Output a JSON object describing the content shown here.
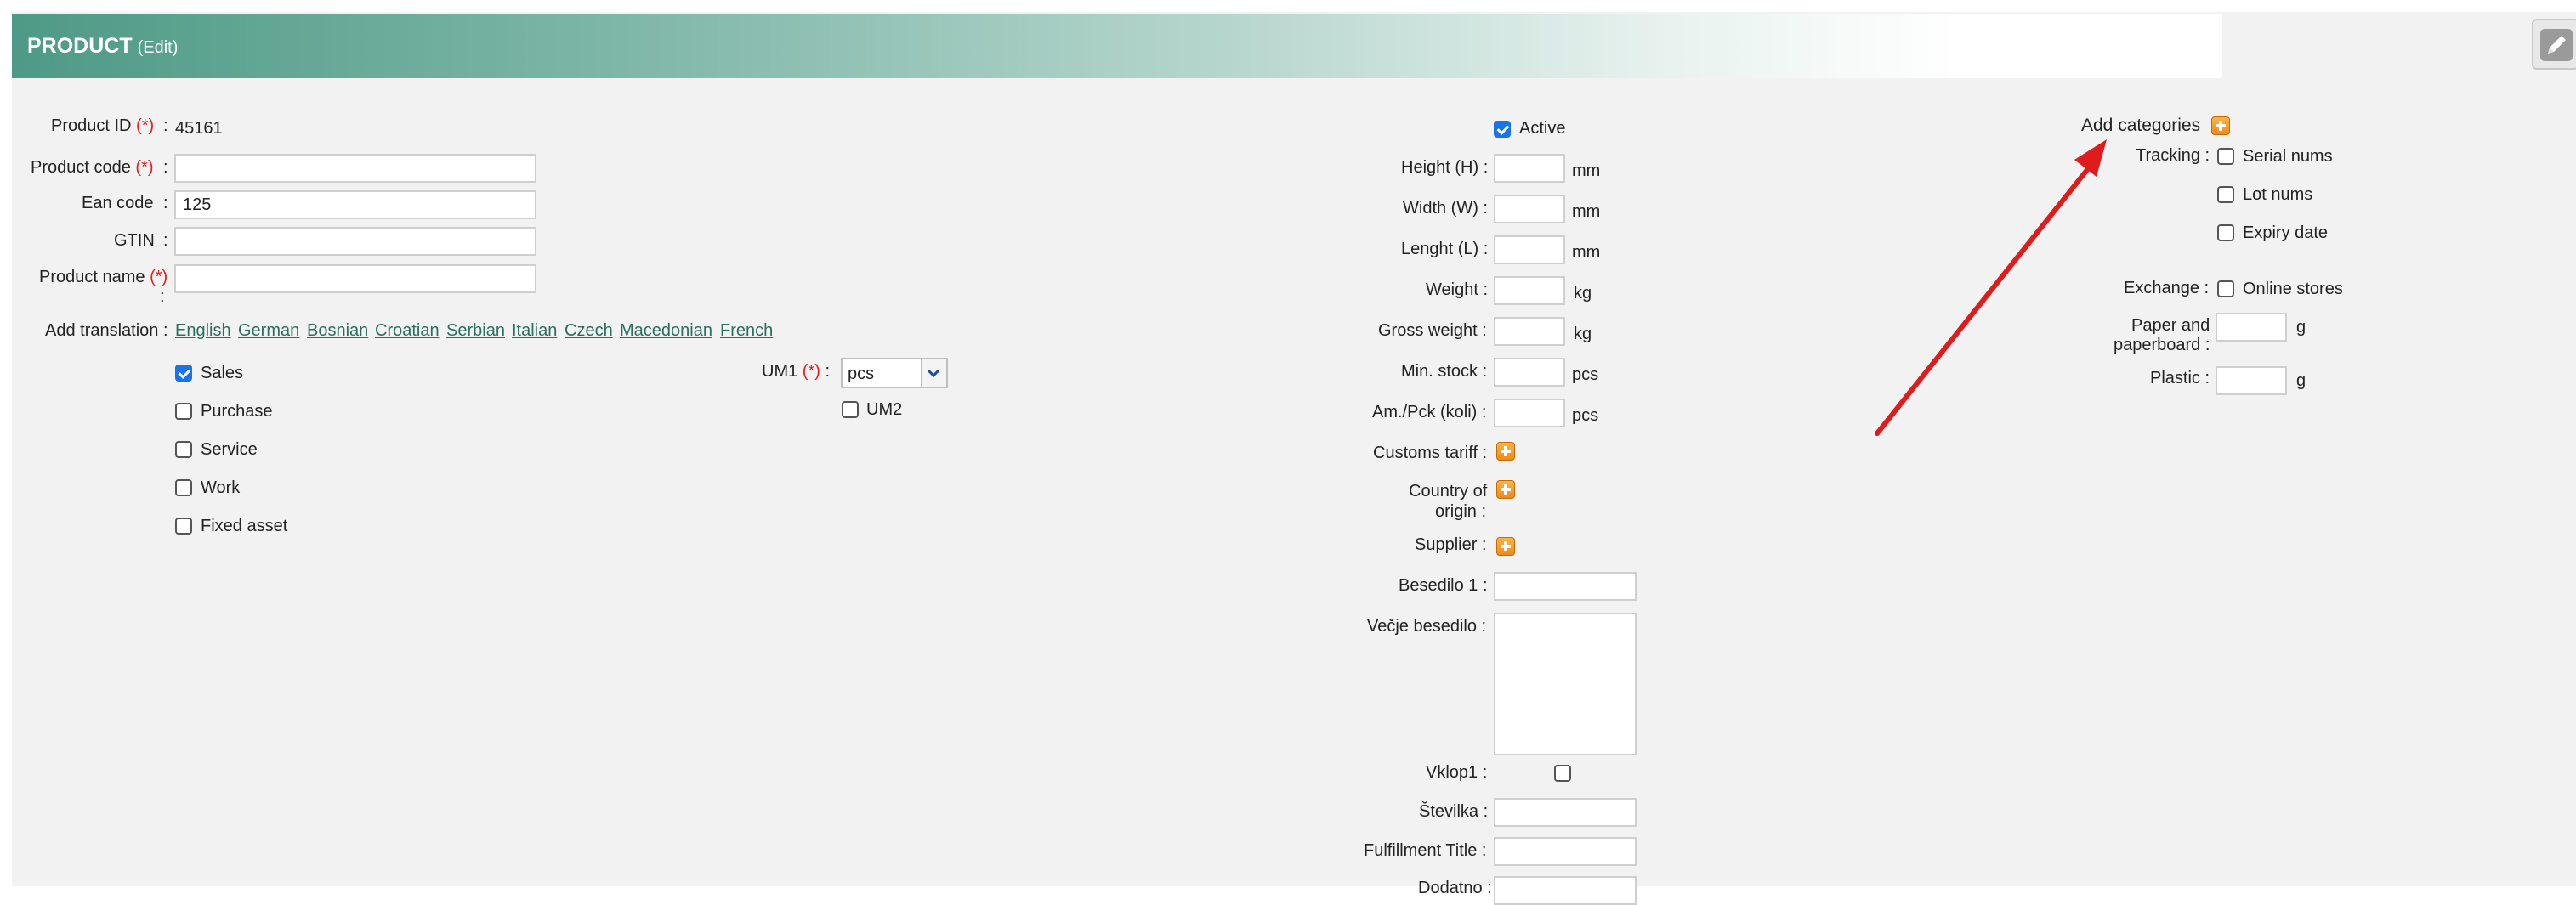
{
  "header": {
    "title": "PRODUCT",
    "subtitle": "(Edit)"
  },
  "req_mark": "(*)",
  "colon": ":",
  "left": {
    "product_id_label": "Product ID",
    "product_id_value": "45161",
    "product_code_label": "Product code",
    "product_code_value": "",
    "ean_label": "Ean code",
    "ean_value": "125",
    "gtin_label": "GTIN",
    "gtin_value": "",
    "product_name_label": "Product name",
    "product_name_value": "",
    "add_translation_label": "Add translation :",
    "languages": [
      "English",
      "German",
      "Bosnian",
      "Croatian",
      "Serbian",
      "Italian",
      "Czech",
      "Macedonian",
      "French"
    ],
    "types": [
      {
        "label": "Sales",
        "checked": true
      },
      {
        "label": "Purchase",
        "checked": false
      },
      {
        "label": "Service",
        "checked": false
      },
      {
        "label": "Work",
        "checked": false
      },
      {
        "label": "Fixed asset",
        "checked": false
      }
    ],
    "um1_label": "UM1",
    "um1_value": "pcs",
    "um2_label": "UM2"
  },
  "middle": {
    "active_label": "Active",
    "height_label": "Height (H) :",
    "width_label": "Width (W) :",
    "length_label": "Lenght (L) :",
    "weight_label": "Weight :",
    "gross_weight_label": "Gross weight :",
    "min_stock_label": "Min. stock :",
    "am_pck_label": "Am./Pck (koli) :",
    "unit_mm": "mm",
    "unit_kg": "kg",
    "unit_pcs": "pcs",
    "customs_label": "Customs tariff :",
    "country_label_1": "Country of",
    "country_label_2": "origin :",
    "supplier_label": "Supplier :",
    "besedilo_label": "Besedilo 1 :",
    "vecje_label": "Večje besedilo :",
    "vklop_label": "Vklop1 :",
    "stevilka_label": "Številka :",
    "fulfillment_label": "Fulfillment Title :",
    "cut_label": "Dodatno :"
  },
  "right": {
    "add_categories_label": "Add categories",
    "tracking_label": "Tracking :",
    "serial_label": "Serial nums",
    "lot_label": "Lot nums",
    "expiry_label": "Expiry date",
    "exchange_label": "Exchange :",
    "online_label": "Online stores",
    "paper_label_1": "Paper and",
    "paper_label_2": "paperboard :",
    "plastic_label": "Plastic :",
    "unit_g": "g"
  },
  "colors": {
    "accent_red": "#e01b1b",
    "header_green": "#4e9a86",
    "link_green": "#2a6e5e",
    "check_blue": "#1a73e8"
  }
}
